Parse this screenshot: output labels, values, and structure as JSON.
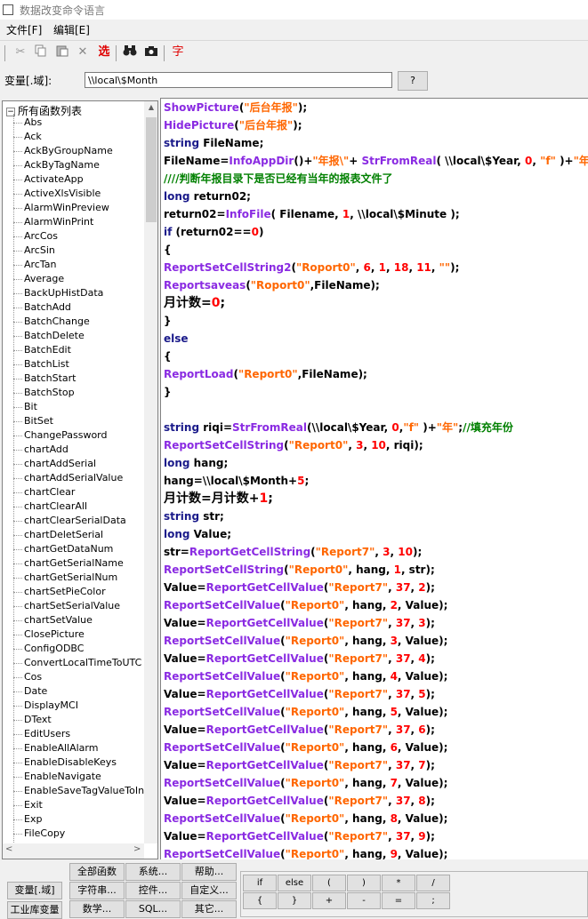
{
  "window": {
    "title": "数据改变命令语言"
  },
  "menu": [
    "文件[F]",
    "编辑[E]"
  ],
  "toolbar": {
    "select_label": "选",
    "char_label": "字"
  },
  "variable": {
    "label": "变量[.域]:",
    "value": "\\\\local\\$Month",
    "help_label": "?"
  },
  "tree": {
    "root_label": "所有函数列表",
    "items": [
      "Abs",
      "Ack",
      "AckByGroupName",
      "AckByTagName",
      "ActivateApp",
      "ActiveXlsVisible",
      "AlarmWinPreview",
      "AlarmWinPrint",
      "ArcCos",
      "ArcSin",
      "ArcTan",
      "Average",
      "BackUpHistData",
      "BatchAdd",
      "BatchChange",
      "BatchDelete",
      "BatchEdit",
      "BatchList",
      "BatchStart",
      "BatchStop",
      "Bit",
      "BitSet",
      "ChangePassword",
      "chartAdd",
      "chartAddSerial",
      "chartAddSerialValue",
      "chartClear",
      "chartClearAll",
      "chartClearSerialData",
      "chartDeletSerial",
      "chartGetDataNum",
      "chartGetSerialName",
      "chartGetSerialNum",
      "chartSetPieColor",
      "chartSetSerialValue",
      "chartSetValue",
      "ClosePicture",
      "ConfigODBC",
      "ConvertLocalTimeToUTC",
      "Cos",
      "Date",
      "DisplayMCI",
      "DText",
      "EditUsers",
      "EnableAllAlarm",
      "EnableDisableKeys",
      "EnableNavigate",
      "EnableSaveTagValueToIni",
      "Exit",
      "Exp",
      "FileCopy"
    ]
  },
  "code_lines": [
    {
      "big": false,
      "tokens": [
        [
          "f",
          "ShowPicture"
        ],
        [
          "d",
          "("
        ],
        [
          "s",
          "\"后台年报\""
        ],
        [
          "d",
          ");"
        ]
      ]
    },
    {
      "big": false,
      "tokens": [
        [
          "f",
          "HidePicture"
        ],
        [
          "d",
          "("
        ],
        [
          "s",
          "\"后台年报\""
        ],
        [
          "d",
          ");"
        ]
      ]
    },
    {
      "big": false,
      "tokens": [
        [
          "k",
          "string"
        ],
        [
          "v",
          " FileName;"
        ]
      ]
    },
    {
      "big": false,
      "tokens": [
        [
          "v",
          "FileName="
        ],
        [
          "f",
          "InfoAppDir"
        ],
        [
          "d",
          "()+"
        ],
        [
          "s",
          "\"年报\\\""
        ],
        [
          "d",
          "+ "
        ],
        [
          "f",
          "StrFromReal"
        ],
        [
          "d",
          "( \\\\local\\$Year, "
        ],
        [
          "n",
          "0"
        ],
        [
          "d",
          ", "
        ],
        [
          "s",
          "\"f\""
        ],
        [
          "d",
          " )+"
        ],
        [
          "s",
          "\"年\""
        ],
        [
          "d",
          "+"
        ]
      ]
    },
    {
      "big": false,
      "tokens": [
        [
          "c",
          "////判断年报目录下是否已经有当年的报表文件了"
        ]
      ]
    },
    {
      "big": false,
      "tokens": [
        [
          "k",
          "long"
        ],
        [
          "v",
          " return02;"
        ]
      ]
    },
    {
      "big": false,
      "tokens": [
        [
          "v",
          "return02="
        ],
        [
          "f",
          "InfoFile"
        ],
        [
          "d",
          "( Filename, "
        ],
        [
          "n",
          "1"
        ],
        [
          "d",
          ", \\\\local\\$Minute );"
        ]
      ]
    },
    {
      "big": false,
      "tokens": [
        [
          "k",
          "if"
        ],
        [
          "d",
          " (return02=="
        ],
        [
          "n",
          "0"
        ],
        [
          "d",
          ")"
        ]
      ]
    },
    {
      "big": false,
      "tokens": [
        [
          "d",
          "{"
        ]
      ]
    },
    {
      "big": false,
      "tokens": [
        [
          "f",
          "ReportSetCellString2"
        ],
        [
          "d",
          "("
        ],
        [
          "s",
          "\"Roport0\""
        ],
        [
          "d",
          ", "
        ],
        [
          "n",
          "6"
        ],
        [
          "d",
          ", "
        ],
        [
          "n",
          "1"
        ],
        [
          "d",
          ", "
        ],
        [
          "n",
          "18"
        ],
        [
          "d",
          ", "
        ],
        [
          "n",
          "11"
        ],
        [
          "d",
          ", "
        ],
        [
          "s",
          "\"\""
        ],
        [
          "d",
          ");"
        ]
      ]
    },
    {
      "big": false,
      "tokens": [
        [
          "f",
          "Reportsaveas"
        ],
        [
          "d",
          "("
        ],
        [
          "s",
          "\"Roport0\""
        ],
        [
          "d",
          ",FileName);"
        ]
      ]
    },
    {
      "big": true,
      "tokens": [
        [
          "v",
          "月计数="
        ],
        [
          "n",
          "0"
        ],
        [
          "d",
          ";"
        ]
      ]
    },
    {
      "big": false,
      "tokens": [
        [
          "d",
          "}"
        ]
      ]
    },
    {
      "big": false,
      "tokens": [
        [
          "k",
          "else"
        ]
      ]
    },
    {
      "big": false,
      "tokens": [
        [
          "d",
          "{"
        ]
      ]
    },
    {
      "big": false,
      "tokens": [
        [
          "f",
          "ReportLoad"
        ],
        [
          "d",
          "("
        ],
        [
          "s",
          "\"Report0\""
        ],
        [
          "d",
          ",FileName);"
        ]
      ]
    },
    {
      "big": false,
      "tokens": [
        [
          "d",
          "}"
        ]
      ]
    },
    {
      "big": false,
      "tokens": []
    },
    {
      "big": false,
      "tokens": [
        [
          "k",
          "string"
        ],
        [
          "v",
          " riqi="
        ],
        [
          "f",
          "StrFromReal"
        ],
        [
          "d",
          "(\\\\local\\$Year, "
        ],
        [
          "n",
          "0"
        ],
        [
          "d",
          ","
        ],
        [
          "s",
          "\"f\""
        ],
        [
          "d",
          " )+"
        ],
        [
          "s",
          "\"年\""
        ],
        [
          "d",
          ";"
        ],
        [
          "c",
          "//填充年份"
        ]
      ]
    },
    {
      "big": false,
      "tokens": [
        [
          "f",
          "ReportSetCellString"
        ],
        [
          "d",
          "("
        ],
        [
          "s",
          "\"Report0\""
        ],
        [
          "d",
          ", "
        ],
        [
          "n",
          "3"
        ],
        [
          "d",
          ", "
        ],
        [
          "n",
          "10"
        ],
        [
          "d",
          ", riqi);"
        ]
      ]
    },
    {
      "big": false,
      "tokens": [
        [
          "k",
          "long"
        ],
        [
          "v",
          " hang;"
        ]
      ]
    },
    {
      "big": false,
      "tokens": [
        [
          "v",
          "hang=\\\\local\\$Month+"
        ],
        [
          "n",
          "5"
        ],
        [
          "d",
          ";"
        ]
      ]
    },
    {
      "big": true,
      "tokens": [
        [
          "v",
          "月计数=月计数+"
        ],
        [
          "n",
          "1"
        ],
        [
          "d",
          ";"
        ]
      ]
    },
    {
      "big": false,
      "tokens": [
        [
          "k",
          "string"
        ],
        [
          "v",
          " str;"
        ]
      ]
    },
    {
      "big": false,
      "tokens": [
        [
          "k",
          "long"
        ],
        [
          "v",
          " Value;"
        ]
      ]
    },
    {
      "big": false,
      "tokens": [
        [
          "v",
          "str="
        ],
        [
          "f",
          "ReportGetCellString"
        ],
        [
          "d",
          "("
        ],
        [
          "s",
          "\"Report7\""
        ],
        [
          "d",
          ", "
        ],
        [
          "n",
          "3"
        ],
        [
          "d",
          ", "
        ],
        [
          "n",
          "10"
        ],
        [
          "d",
          ");"
        ]
      ]
    },
    {
      "big": false,
      "tokens": [
        [
          "f",
          "ReportSetCellString"
        ],
        [
          "d",
          "("
        ],
        [
          "s",
          "\"Report0\""
        ],
        [
          "d",
          ", hang, "
        ],
        [
          "n",
          "1"
        ],
        [
          "d",
          ", str);"
        ]
      ]
    },
    {
      "big": false,
      "tokens": [
        [
          "v",
          "Value="
        ],
        [
          "f",
          "ReportGetCellValue"
        ],
        [
          "d",
          "("
        ],
        [
          "s",
          "\"Report7\""
        ],
        [
          "d",
          ", "
        ],
        [
          "n",
          "37"
        ],
        [
          "d",
          ", "
        ],
        [
          "n",
          "2"
        ],
        [
          "d",
          ");"
        ]
      ]
    },
    {
      "big": false,
      "tokens": [
        [
          "f",
          "ReportSetCellValue"
        ],
        [
          "d",
          "("
        ],
        [
          "s",
          "\"Report0\""
        ],
        [
          "d",
          ", hang, "
        ],
        [
          "n",
          "2"
        ],
        [
          "d",
          ", Value);"
        ]
      ]
    },
    {
      "big": false,
      "tokens": [
        [
          "v",
          "Value="
        ],
        [
          "f",
          "ReportGetCellValue"
        ],
        [
          "d",
          "("
        ],
        [
          "s",
          "\"Report7\""
        ],
        [
          "d",
          ", "
        ],
        [
          "n",
          "37"
        ],
        [
          "d",
          ", "
        ],
        [
          "n",
          "3"
        ],
        [
          "d",
          ");"
        ]
      ]
    },
    {
      "big": false,
      "tokens": [
        [
          "f",
          "ReportSetCellValue"
        ],
        [
          "d",
          "("
        ],
        [
          "s",
          "\"Report0\""
        ],
        [
          "d",
          ", hang, "
        ],
        [
          "n",
          "3"
        ],
        [
          "d",
          ", Value);"
        ]
      ]
    },
    {
      "big": false,
      "tokens": [
        [
          "v",
          "Value="
        ],
        [
          "f",
          "ReportGetCellValue"
        ],
        [
          "d",
          "("
        ],
        [
          "s",
          "\"Report7\""
        ],
        [
          "d",
          ", "
        ],
        [
          "n",
          "37"
        ],
        [
          "d",
          ", "
        ],
        [
          "n",
          "4"
        ],
        [
          "d",
          ");"
        ]
      ]
    },
    {
      "big": false,
      "tokens": [
        [
          "f",
          "ReportSetCellValue"
        ],
        [
          "d",
          "("
        ],
        [
          "s",
          "\"Report0\""
        ],
        [
          "d",
          ", hang, "
        ],
        [
          "n",
          "4"
        ],
        [
          "d",
          ", Value);"
        ]
      ]
    },
    {
      "big": false,
      "tokens": [
        [
          "v",
          "Value="
        ],
        [
          "f",
          "ReportGetCellValue"
        ],
        [
          "d",
          "("
        ],
        [
          "s",
          "\"Report7\""
        ],
        [
          "d",
          ", "
        ],
        [
          "n",
          "37"
        ],
        [
          "d",
          ", "
        ],
        [
          "n",
          "5"
        ],
        [
          "d",
          ");"
        ]
      ]
    },
    {
      "big": false,
      "tokens": [
        [
          "f",
          "ReportSetCellValue"
        ],
        [
          "d",
          "("
        ],
        [
          "s",
          "\"Report0\""
        ],
        [
          "d",
          ", hang, "
        ],
        [
          "n",
          "5"
        ],
        [
          "d",
          ", Value);"
        ]
      ]
    },
    {
      "big": false,
      "tokens": [
        [
          "v",
          "Value="
        ],
        [
          "f",
          "ReportGetCellValue"
        ],
        [
          "d",
          "("
        ],
        [
          "s",
          "\"Report7\""
        ],
        [
          "d",
          ", "
        ],
        [
          "n",
          "37"
        ],
        [
          "d",
          ", "
        ],
        [
          "n",
          "6"
        ],
        [
          "d",
          ");"
        ]
      ]
    },
    {
      "big": false,
      "tokens": [
        [
          "f",
          "ReportSetCellValue"
        ],
        [
          "d",
          "("
        ],
        [
          "s",
          "\"Report0\""
        ],
        [
          "d",
          ", hang, "
        ],
        [
          "n",
          "6"
        ],
        [
          "d",
          ", Value);"
        ]
      ]
    },
    {
      "big": false,
      "tokens": [
        [
          "v",
          "Value="
        ],
        [
          "f",
          "ReportGetCellValue"
        ],
        [
          "d",
          "("
        ],
        [
          "s",
          "\"Report7\""
        ],
        [
          "d",
          ", "
        ],
        [
          "n",
          "37"
        ],
        [
          "d",
          ", "
        ],
        [
          "n",
          "7"
        ],
        [
          "d",
          ");"
        ]
      ]
    },
    {
      "big": false,
      "tokens": [
        [
          "f",
          "ReportSetCellValue"
        ],
        [
          "d",
          "("
        ],
        [
          "s",
          "\"Report0\""
        ],
        [
          "d",
          ", hang, "
        ],
        [
          "n",
          "7"
        ],
        [
          "d",
          ", Value);"
        ]
      ]
    },
    {
      "big": false,
      "tokens": [
        [
          "v",
          "Value="
        ],
        [
          "f",
          "ReportGetCellValue"
        ],
        [
          "d",
          "("
        ],
        [
          "s",
          "\"Report7\""
        ],
        [
          "d",
          ", "
        ],
        [
          "n",
          "37"
        ],
        [
          "d",
          ", "
        ],
        [
          "n",
          "8"
        ],
        [
          "d",
          ");"
        ]
      ]
    },
    {
      "big": false,
      "tokens": [
        [
          "f",
          "ReportSetCellValue"
        ],
        [
          "d",
          "("
        ],
        [
          "s",
          "\"Report0\""
        ],
        [
          "d",
          ", hang, "
        ],
        [
          "n",
          "8"
        ],
        [
          "d",
          ", Value);"
        ]
      ]
    },
    {
      "big": false,
      "tokens": [
        [
          "v",
          "Value="
        ],
        [
          "f",
          "ReportGetCellValue"
        ],
        [
          "d",
          "("
        ],
        [
          "s",
          "\"Report7\""
        ],
        [
          "d",
          ", "
        ],
        [
          "n",
          "37"
        ],
        [
          "d",
          ", "
        ],
        [
          "n",
          "9"
        ],
        [
          "d",
          ");"
        ]
      ]
    },
    {
      "big": false,
      "tokens": [
        [
          "f",
          "ReportSetCellValue"
        ],
        [
          "d",
          "("
        ],
        [
          "s",
          "\"Report0\""
        ],
        [
          "d",
          ", hang, "
        ],
        [
          "n",
          "9"
        ],
        [
          "d",
          ", Value);"
        ]
      ]
    }
  ],
  "bottom": {
    "var_button": "变量[.域]",
    "lib_button": "工业库变量",
    "func_buttons": [
      "全部函数",
      "系统...",
      "帮助...",
      "字符串...",
      "控件...",
      "自定义...",
      "数学...",
      "SQL...",
      "其它..."
    ],
    "op_buttons": [
      "if",
      "else",
      "(",
      ")",
      "*",
      "/",
      "{",
      "}",
      "+",
      "-",
      "=",
      ";"
    ]
  },
  "colors": {
    "function": "#8a2be2",
    "keyword": "#1a1a8a",
    "string": "#ff6600",
    "number": "#ff0000",
    "comment": "#008000"
  }
}
